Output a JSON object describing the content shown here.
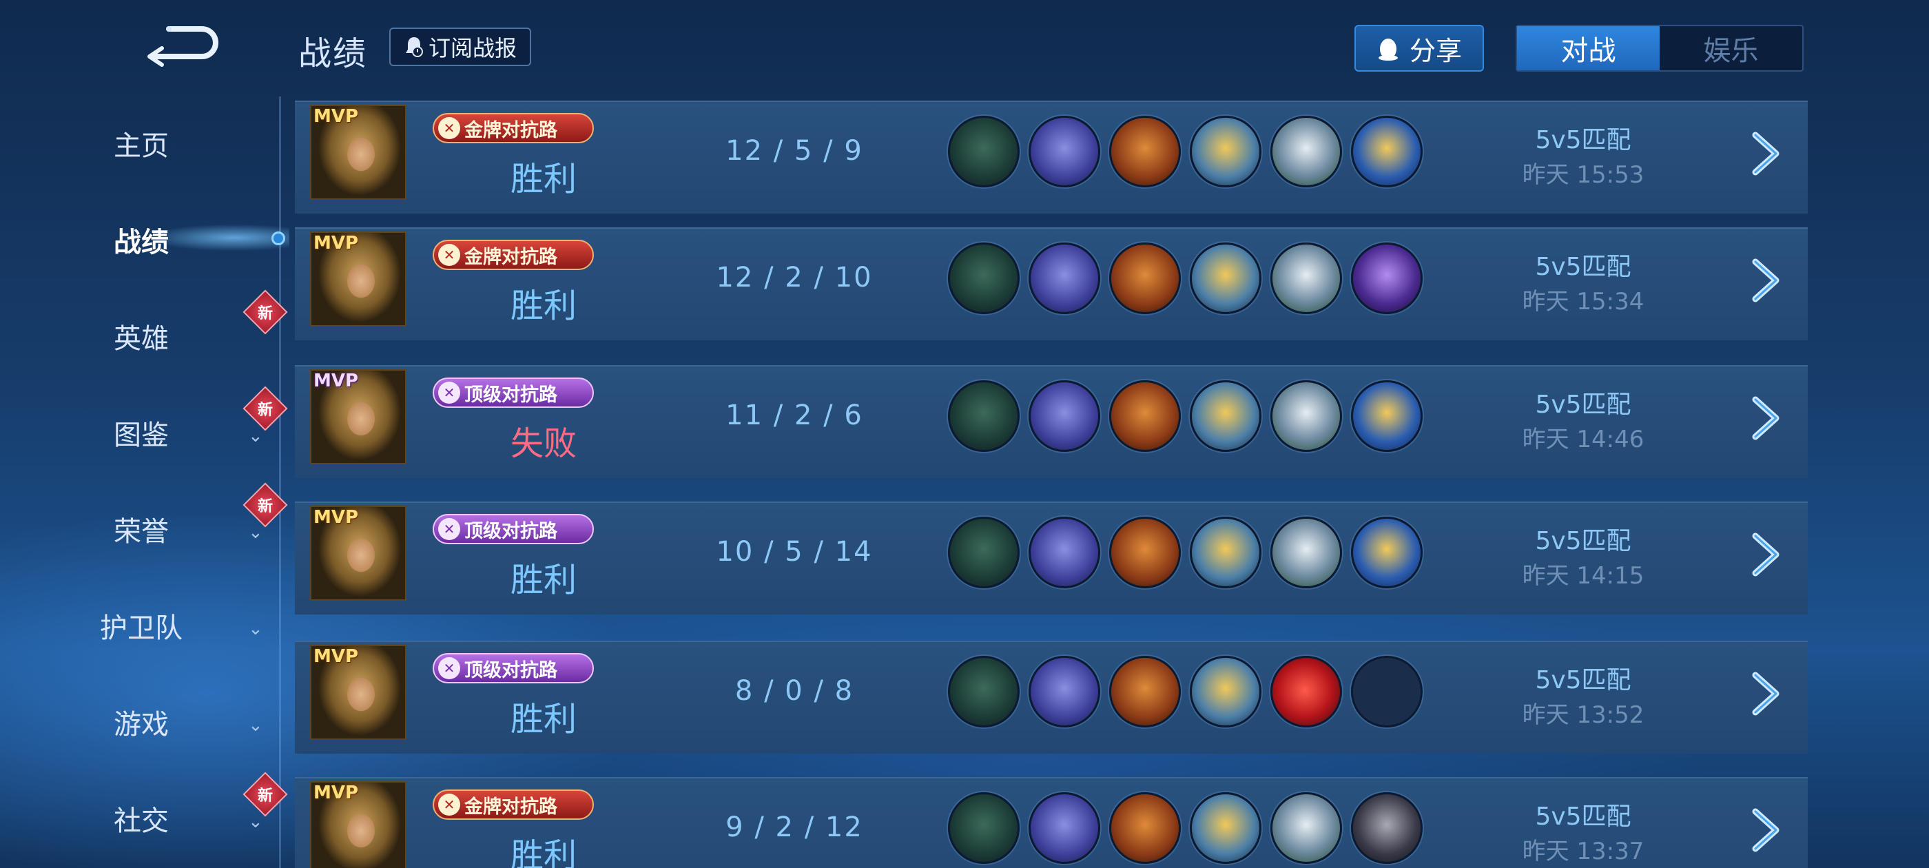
{
  "header": {
    "title": "战绩",
    "subscribe_label": "订阅战报",
    "share_label": "分享",
    "tabs": [
      {
        "label": "对战",
        "active": true
      },
      {
        "label": "娱乐",
        "active": false
      }
    ]
  },
  "sidebar": {
    "items": [
      {
        "label": "主页",
        "chevron": false,
        "new": false,
        "active": false
      },
      {
        "label": "战绩",
        "chevron": false,
        "new": false,
        "active": true
      },
      {
        "label": "英雄",
        "chevron": false,
        "new": true,
        "active": false
      },
      {
        "label": "图鉴",
        "chevron": true,
        "new": true,
        "active": false
      },
      {
        "label": "荣誉",
        "chevron": true,
        "new": true,
        "active": false
      },
      {
        "label": "护卫队",
        "chevron": true,
        "new": false,
        "active": false
      },
      {
        "label": "游戏",
        "chevron": true,
        "new": false,
        "active": false
      },
      {
        "label": "社交",
        "chevron": true,
        "new": true,
        "active": false
      }
    ],
    "new_badge_text": "新"
  },
  "matches": [
    {
      "mvp": "MVP",
      "mvp_style": "gold",
      "lane": "金牌对抗路",
      "lane_style": "gold",
      "result": "胜利",
      "result_type": "win",
      "k": "12",
      "d": "5",
      "a": "9",
      "mode": "5v5匹配",
      "time": "昨天 15:53",
      "items": [
        "boots-item-icon",
        "sword-item-icon",
        "hammer-item-icon",
        "gold-shield-item-icon",
        "silver-armor-item-icon",
        "trident-item-icon"
      ]
    },
    {
      "mvp": "MVP",
      "mvp_style": "gold",
      "lane": "金牌对抗路",
      "lane_style": "gold",
      "result": "胜利",
      "result_type": "win",
      "k": "12",
      "d": "2",
      "a": "10",
      "mode": "5v5匹配",
      "time": "昨天 15:34",
      "items": [
        "boots-item-icon",
        "sword-item-icon",
        "hammer-item-icon",
        "gold-shield-item-icon",
        "silver-armor-item-icon",
        "dark-trident-item-icon"
      ]
    },
    {
      "mvp": "MVP",
      "mvp_style": "purple",
      "lane": "顶级对抗路",
      "lane_style": "purple",
      "result": "失败",
      "result_type": "lose",
      "k": "11",
      "d": "2",
      "a": "6",
      "mode": "5v5匹配",
      "time": "昨天 14:46",
      "items": [
        "boots-item-icon",
        "sword-item-icon",
        "hammer-item-icon",
        "gold-shield-item-icon",
        "silver-armor-item-icon",
        "trident-item-icon"
      ]
    },
    {
      "mvp": "MVP",
      "mvp_style": "gold",
      "lane": "顶级对抗路",
      "lane_style": "purple",
      "result": "胜利",
      "result_type": "win",
      "k": "10",
      "d": "5",
      "a": "14",
      "mode": "5v5匹配",
      "time": "昨天 14:15",
      "items": [
        "boots-item-icon",
        "sword-item-icon",
        "hammer-item-icon",
        "gold-shield-item-icon",
        "silver-armor-item-icon",
        "trident-item-icon"
      ]
    },
    {
      "mvp": "MVP",
      "mvp_style": "gold",
      "lane": "顶级对抗路",
      "lane_style": "purple",
      "result": "胜利",
      "result_type": "win",
      "k": "8",
      "d": "0",
      "a": "8",
      "mode": "5v5匹配",
      "time": "昨天 13:52",
      "items": [
        "boots-item-icon",
        "sword-item-icon",
        "hammer-item-icon",
        "gold-shield-item-icon",
        "red-gem-item-icon",
        "empty-slot"
      ]
    },
    {
      "mvp": "MVP",
      "mvp_style": "gold",
      "lane": "金牌对抗路",
      "lane_style": "gold",
      "result": "胜利",
      "result_type": "win",
      "k": "9",
      "d": "2",
      "a": "12",
      "mode": "5v5匹配",
      "time": "昨天 13:37",
      "items": [
        "boots-item-icon",
        "sword-item-icon",
        "hammer-item-icon",
        "gold-shield-item-icon",
        "silver-armor-item-icon",
        "dark-spear-item-icon"
      ]
    }
  ],
  "kda_separator": "/",
  "colors": {
    "accent": "#2f86de",
    "win": "#7cc8ff",
    "lose": "#ff6b84",
    "row_bg": "#2a527f"
  }
}
